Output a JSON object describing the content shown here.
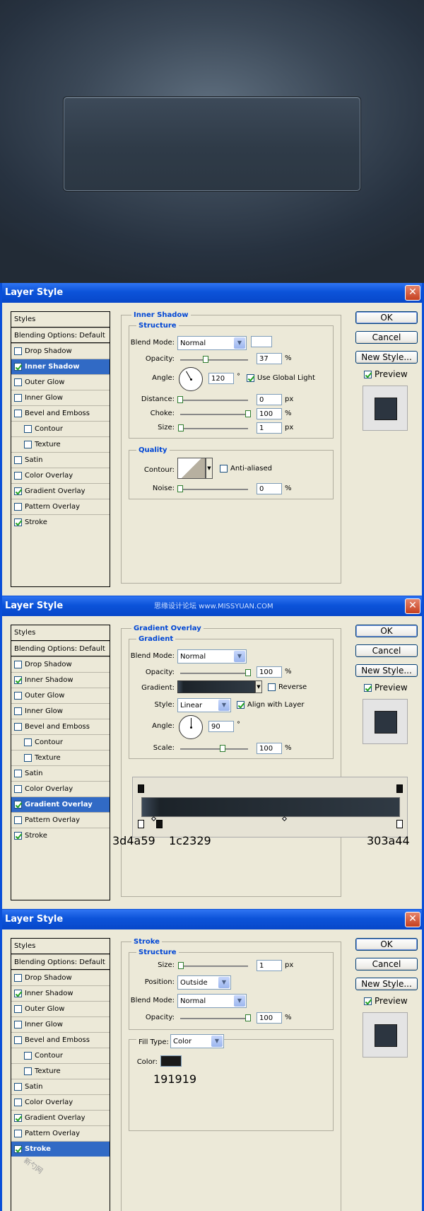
{
  "dialog_title": "Layer Style",
  "close_glyph": "✕",
  "watermark": "思缘设计论坛 www.MISSYUAN.COM",
  "corner_mark": "新勺网",
  "styles_list": {
    "header": "Styles",
    "blending": "Blending Options: Default",
    "items": [
      {
        "label": "Drop Shadow",
        "indent": false
      },
      {
        "label": "Inner Shadow",
        "indent": false
      },
      {
        "label": "Outer Glow",
        "indent": false
      },
      {
        "label": "Inner Glow",
        "indent": false
      },
      {
        "label": "Bevel and Emboss",
        "indent": false
      },
      {
        "label": "Contour",
        "indent": true
      },
      {
        "label": "Texture",
        "indent": true
      },
      {
        "label": "Satin",
        "indent": false
      },
      {
        "label": "Color Overlay",
        "indent": false
      },
      {
        "label": "Gradient Overlay",
        "indent": false
      },
      {
        "label": "Pattern Overlay",
        "indent": false
      },
      {
        "label": "Stroke",
        "indent": false
      }
    ]
  },
  "buttons": {
    "ok": "OK",
    "cancel": "Cancel",
    "new_style": "New Style...",
    "preview": "Preview"
  },
  "dialog1": {
    "section": "Inner Shadow",
    "structure": "Structure",
    "blend_mode_label": "Blend Mode:",
    "blend_mode": "Normal",
    "opacity_label": "Opacity:",
    "opacity": "37",
    "opacity_pct": 37,
    "angle_label": "Angle:",
    "angle": "120",
    "angle_deg": 120,
    "use_global_light": "Use Global Light",
    "distance_label": "Distance:",
    "distance": "0",
    "choke_label": "Choke:",
    "choke": "100",
    "size_label": "Size:",
    "size": "1",
    "quality": "Quality",
    "contour_label": "Contour:",
    "anti_aliased": "Anti-aliased",
    "noise_label": "Noise:",
    "noise": "0",
    "unit_pct": "%",
    "unit_px": "px",
    "unit_deg": "°",
    "checked": [
      "Inner Shadow",
      "Gradient Overlay",
      "Stroke"
    ],
    "selected": "Inner Shadow"
  },
  "dialog2": {
    "section": "Gradient Overlay",
    "structure": "Gradient",
    "blend_mode_label": "Blend Mode:",
    "blend_mode": "Normal",
    "opacity_label": "Opacity:",
    "opacity": "100",
    "gradient_label": "Gradient:",
    "reverse": "Reverse",
    "style_label": "Style:",
    "style": "Linear",
    "align_with_layer": "Align with Layer",
    "angle_label": "Angle:",
    "angle": "90",
    "angle_deg": 90,
    "scale_label": "Scale:",
    "scale": "100",
    "stops": [
      "3d4a59",
      "1c2329",
      "303a44"
    ],
    "checked": [
      "Inner Shadow",
      "Gradient Overlay",
      "Stroke"
    ],
    "selected": "Gradient Overlay"
  },
  "dialog3": {
    "section": "Stroke",
    "structure": "Structure",
    "size_label": "Size:",
    "size": "1",
    "position_label": "Position:",
    "position": "Outside",
    "blend_mode_label": "Blend Mode:",
    "blend_mode": "Normal",
    "opacity_label": "Opacity:",
    "opacity": "100",
    "fill_type_label": "Fill Type:",
    "fill_type": "Color",
    "color_label": "Color:",
    "color_hex": "191919",
    "checked": [
      "Inner Shadow",
      "Gradient Overlay",
      "Stroke"
    ],
    "selected": "Stroke"
  },
  "colors": {
    "stroke_color": "#191919",
    "hero_btn": "#2f3b48",
    "title_bar": "#0c53d9"
  }
}
